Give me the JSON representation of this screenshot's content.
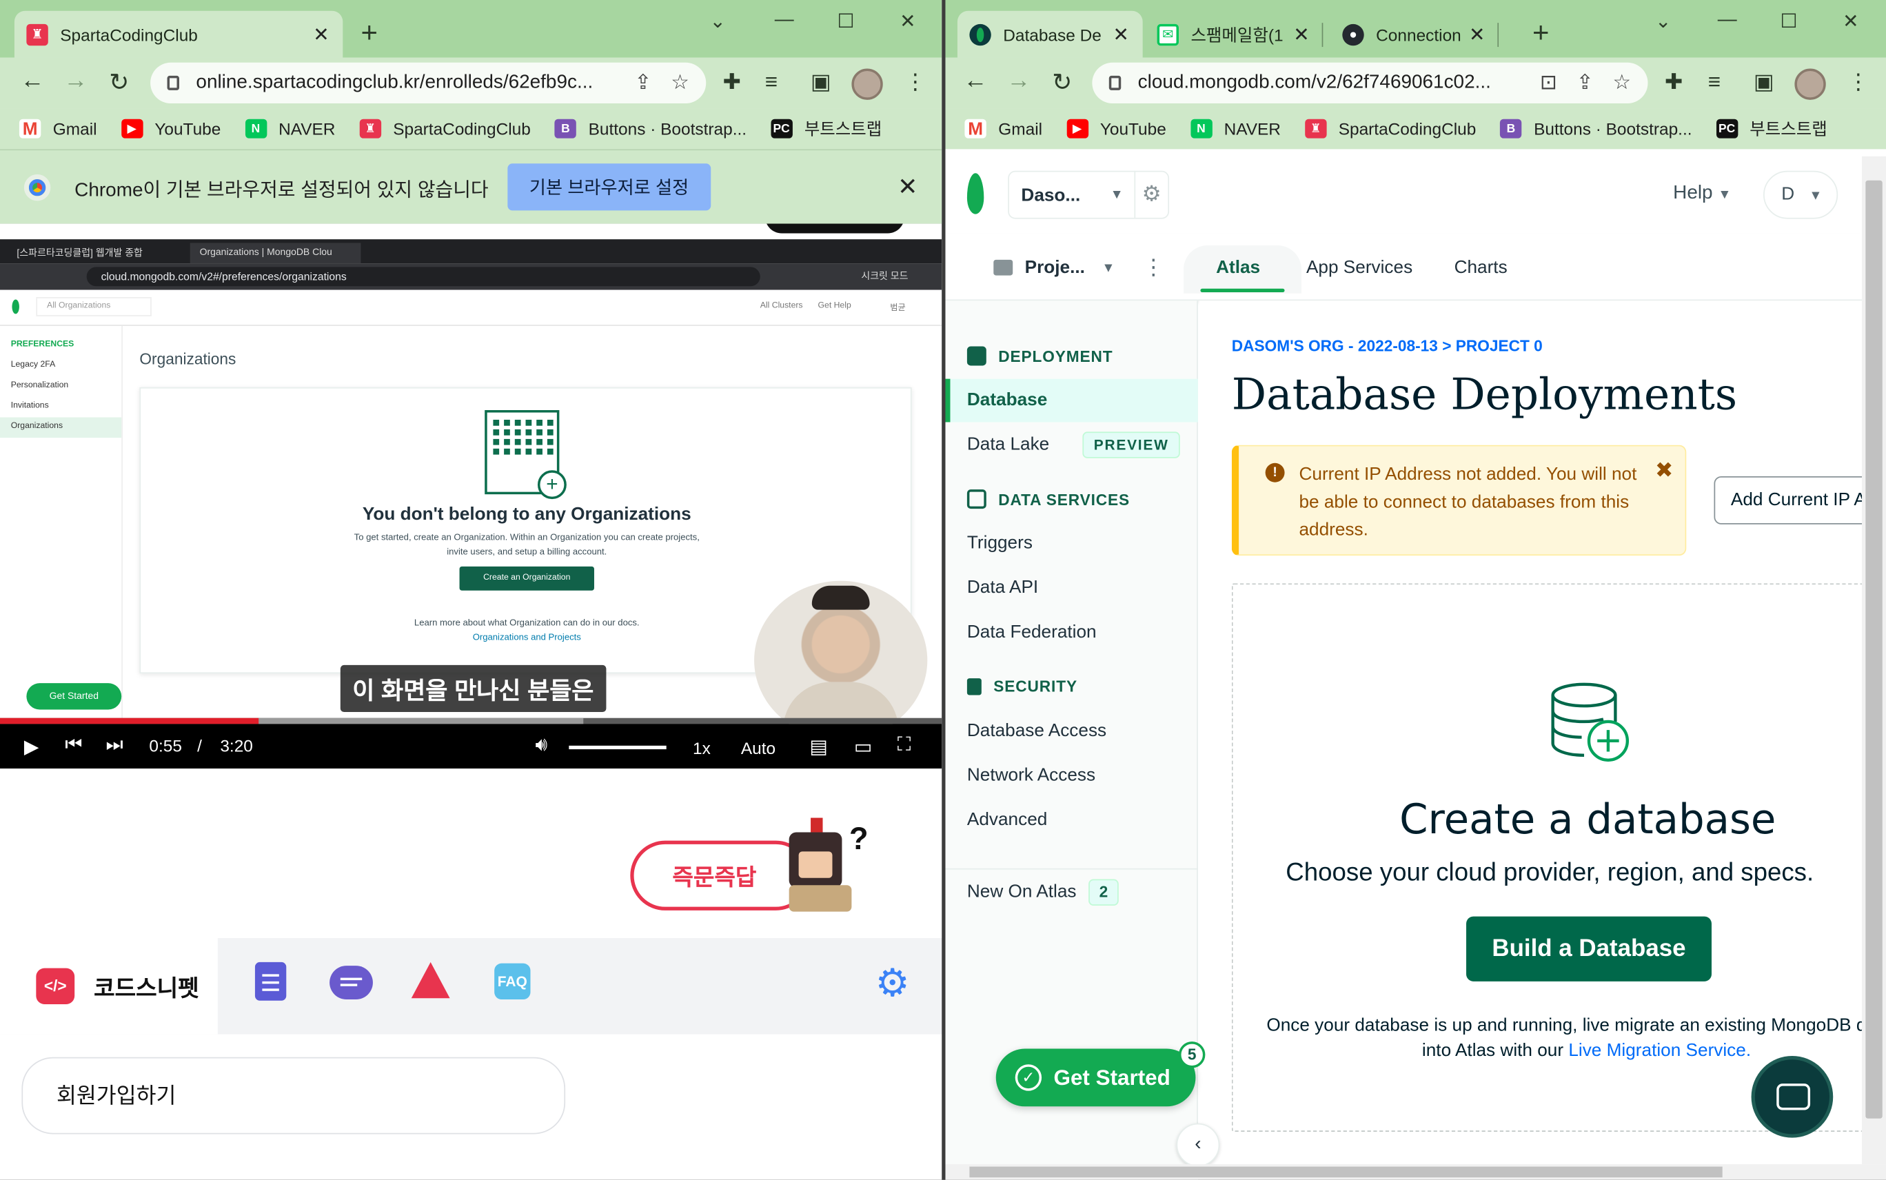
{
  "left_window": {
    "tab_title": "SpartaCodingClub",
    "url": "online.spartacodingclub.kr/enrolleds/62efb9c...",
    "bookmarks": [
      "Gmail",
      "YouTube",
      "NAVER",
      "SpartaCodingClub",
      "Buttons · Bootstrap...",
      "부트스트랩"
    ],
    "infobar": {
      "message": "Chrome이 기본 브라우저로 설정되어 있지 않습니다",
      "button": "기본 브라우저로 설정"
    },
    "video": {
      "inner_tabs": [
        "[스파르타코딩클럽] 웹개발 종합",
        "Organizations | MongoDB Clou"
      ],
      "inner_url": "cloud.mongodb.com/v2#/preferences/organizations",
      "inner_incognito": "시크릿 모드",
      "inner_org_selector": "All Organizations",
      "inner_header_links": [
        "All Clusters",
        "Get Help",
        "범균"
      ],
      "inner_sidebar": [
        "PREFERENCES",
        "Legacy 2FA",
        "Personalization",
        "Invitations",
        "Organizations"
      ],
      "inner_page_title": "Organizations",
      "inner_card_heading": "You don't belong to any Organizations",
      "inner_card_text": "To get started, create an Organization. Within an Organization you can create projects, invite users, and setup a billing account.",
      "inner_card_button": "Create an Organization",
      "inner_card_learn": "Learn more about what Organization can do in our docs.",
      "inner_card_link": "Organizations and Projects",
      "inner_get_started": "Get Started",
      "subtitle": "이 화면을 만나신 분들은",
      "time_current": "0:55",
      "time_separator": "/",
      "time_total": "3:20",
      "progress_played": 0.275,
      "progress_buffered": 0.62,
      "speed": "1x",
      "quality": "Auto"
    },
    "quiz_button": "즉문즉답",
    "snippet_label": "코드스니펫",
    "faq_label": "FAQ",
    "signup_label": "회원가입하기"
  },
  "right_window": {
    "tabs": [
      "Database De",
      "스팸메일함(1",
      "Connection"
    ],
    "url": "cloud.mongodb.com/v2/62f7469061c02...",
    "bookmarks": [
      "Gmail",
      "YouTube",
      "NAVER",
      "SpartaCodingClub",
      "Buttons · Bootstrap...",
      "부트스트랩"
    ],
    "org_name": "Daso...",
    "help": "Help",
    "user_initial": "D",
    "project_name": "Proje...",
    "nav_tabs": [
      "Atlas",
      "App Services",
      "Charts"
    ],
    "sidebar": {
      "deployment_header": "DEPLOYMENT",
      "database": "Database",
      "data_lake": "Data Lake",
      "preview_badge": "PREVIEW",
      "data_services_header": "DATA SERVICES",
      "triggers": "Triggers",
      "data_api": "Data API",
      "data_federation": "Data Federation",
      "security_header": "SECURITY",
      "database_access": "Database Access",
      "network_access": "Network Access",
      "advanced": "Advanced",
      "new_on_atlas": "New On Atlas",
      "new_count": "2",
      "get_started": "Get Started",
      "get_started_count": "5"
    },
    "breadcrumb": "DASOM'S ORG - 2022-08-13 > PROJECT 0",
    "page_title": "Database Deployments",
    "warning": "Current IP Address not added. You will not be able to connect to databases from this address.",
    "add_ip_button": "Add Current IP Address",
    "create_title": "Create a database",
    "create_subtitle": "Choose your cloud provider, region, and specs.",
    "build_button": "Build a Database",
    "migrate_text": "Once your database is up and running, live migrate an existing MongoDB database",
    "migrate_text2": "into Atlas with our",
    "migrate_link": "Live Migration Service."
  },
  "colors": {
    "chrome_frame": "#a7d6a0",
    "chrome_toolbar": "#cfe8c9",
    "mongo_green": "#13aa52",
    "mongo_dark_green": "#00684a",
    "warning_bg": "#fef7db",
    "youtube_red": "#e01e2a",
    "sparta_red": "#e8344e"
  }
}
